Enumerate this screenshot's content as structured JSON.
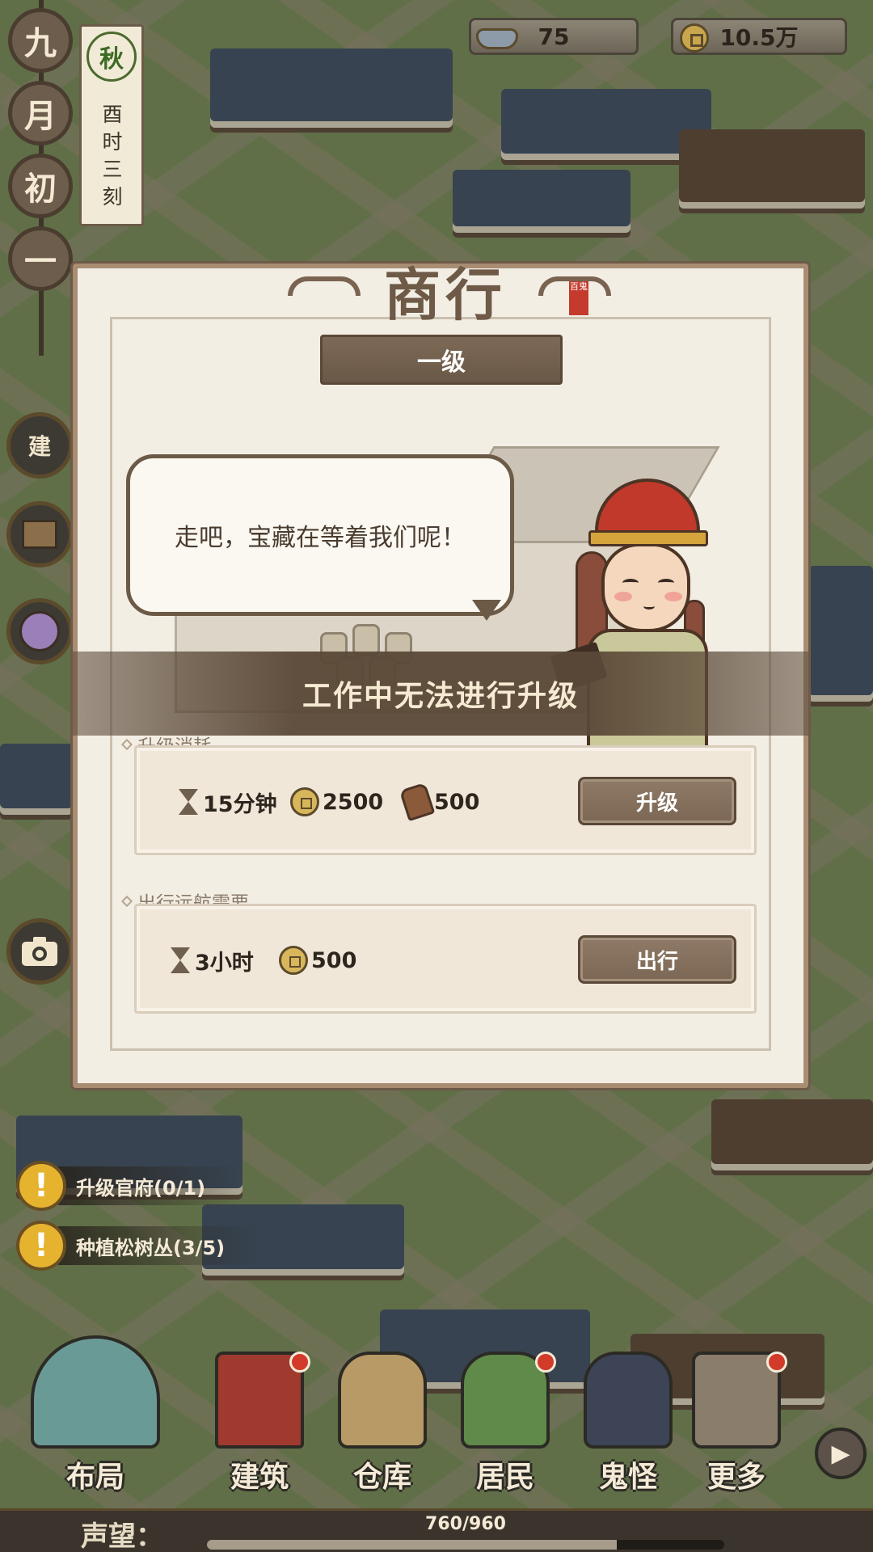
{
  "top_bar": {
    "silver": "75",
    "coins": "10.5万"
  },
  "calendar": {
    "day_chars": [
      "九",
      "月",
      "初",
      "一"
    ],
    "season": "秋",
    "time_chars": [
      "酉",
      "时",
      "三",
      "刻"
    ]
  },
  "side_buttons": {
    "build": "建"
  },
  "panel": {
    "title": "商行",
    "seal": "百鬼",
    "level": "一级",
    "speech": "走吧，宝藏在等着我们呢！",
    "status": "工作中无法进行升级",
    "upgrade": {
      "label": "升级消耗",
      "time": "15分钟",
      "coins": "2500",
      "wood": "500",
      "button": "升级"
    },
    "voyage": {
      "label": "出行远航需要",
      "time": "3小时",
      "coins": "500",
      "button": "出行"
    }
  },
  "quests": [
    {
      "text": "升级官府(0/1)"
    },
    {
      "text": "种植松树丛(3/5)"
    }
  ],
  "nav": {
    "items": [
      {
        "label": "布局"
      },
      {
        "label": "建筑"
      },
      {
        "label": "仓库"
      },
      {
        "label": "居民"
      },
      {
        "label": "鬼怪"
      },
      {
        "label": "更多"
      }
    ]
  },
  "reputation": {
    "label": "声望：",
    "value_text": "760/960",
    "current": 760,
    "max": 960
  },
  "colors": {
    "panel_bg": "#f3eee4",
    "button_brown": "#7b6754",
    "notice_red": "#d23a2a",
    "quest_yellow": "#e6b32f"
  }
}
